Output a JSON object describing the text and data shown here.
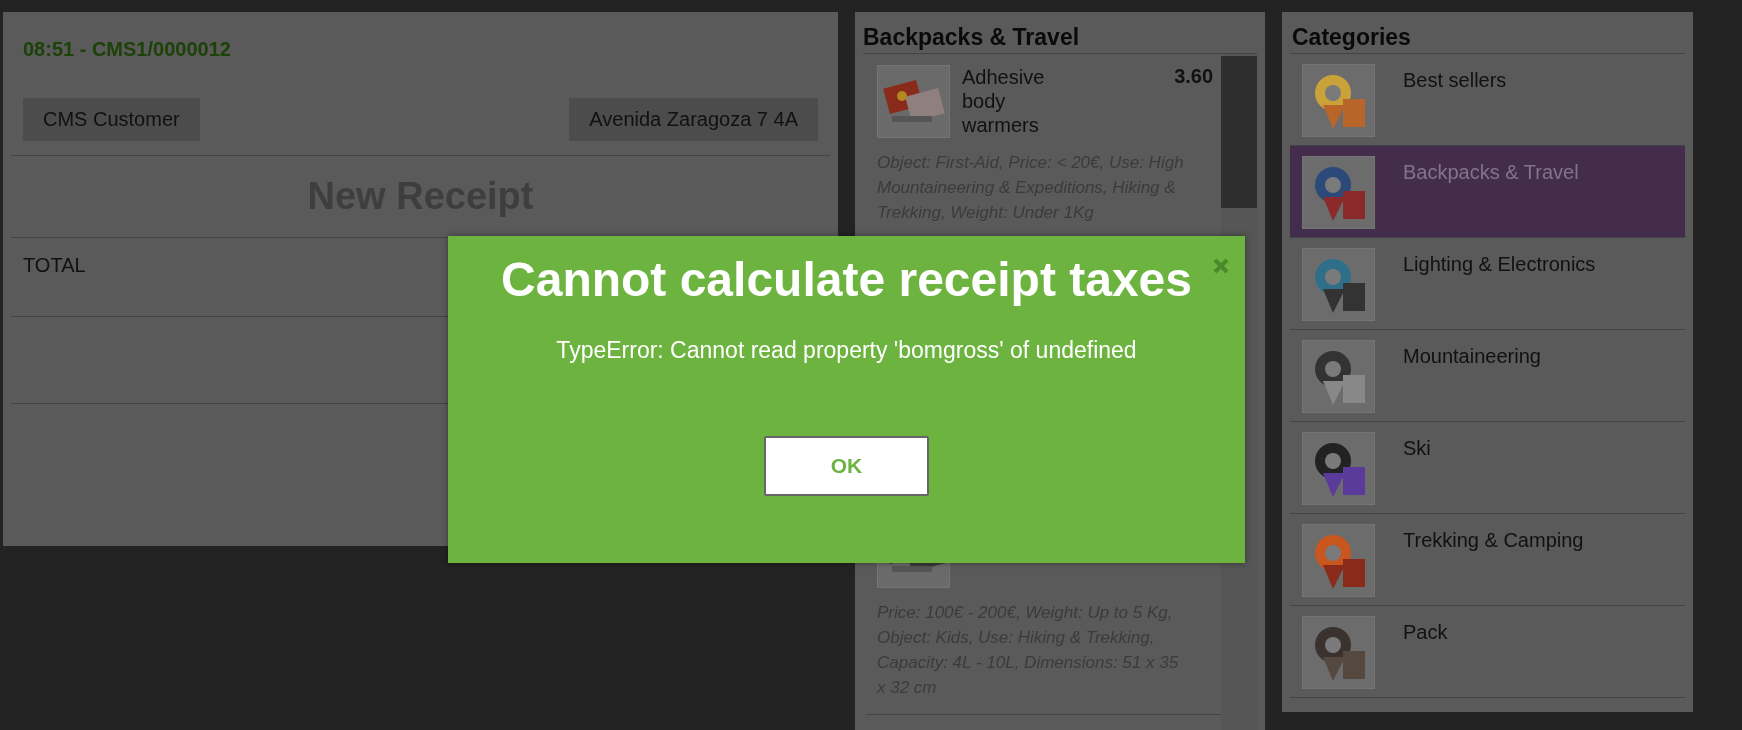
{
  "receipt": {
    "title": "08:51 - CMS1/0000012",
    "customer_button": "CMS Customer",
    "address_button": "Avenida Zaragoza 7 4A",
    "heading": "New Receipt",
    "total_label": "TOTAL"
  },
  "products": {
    "title": "Backpacks & Travel",
    "items": [
      {
        "kind": "picture",
        "name": "Adhesive body warmers",
        "price": "3.60",
        "description": "Object: First-Aid, Price: < 20€, Use: High Mountaineering & Expeditions, Hiking & Trekking, Weight: Under 1Kg"
      },
      {
        "kind": "picture",
        "description": "Price: 100€ - 200€, Weight: Up to 5 Kg, Object: Kids, Use: Hiking & Trekking, Capacity: 4L - 10L, Dimensions: 51 x 35 x 32 cm"
      }
    ]
  },
  "categories": {
    "title": "Categories",
    "items": [
      {
        "label": "Best sellers",
        "selected": false
      },
      {
        "label": "Backpacks & Travel",
        "selected": true
      },
      {
        "label": "Lighting & Electronics",
        "selected": false
      },
      {
        "label": "Mountaineering",
        "selected": false
      },
      {
        "label": "Ski",
        "selected": false
      },
      {
        "label": "Trekking & Camping",
        "selected": false
      },
      {
        "label": "Pack",
        "selected": false
      }
    ]
  },
  "dialog": {
    "title": "Cannot calculate receipt taxes",
    "message": "TypeError: Cannot read property 'bomgross' of undefined",
    "button": "OK"
  }
}
